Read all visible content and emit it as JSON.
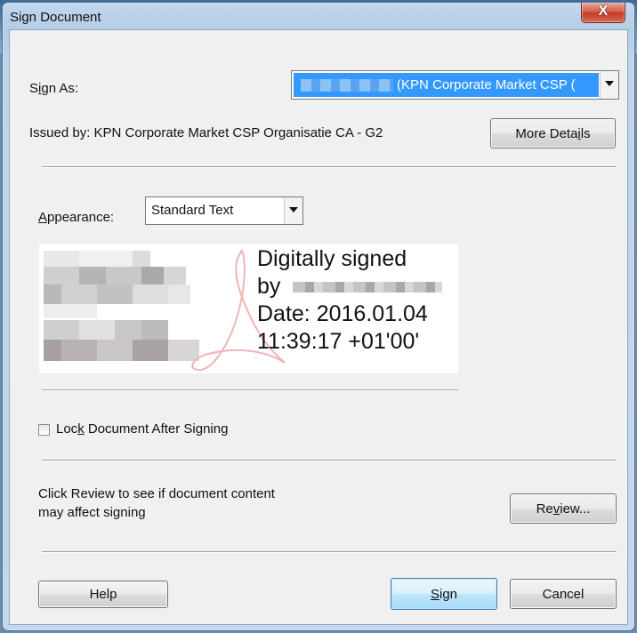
{
  "dialog": {
    "title": "Sign Document",
    "close_label": "X"
  },
  "sign_as": {
    "label_pre": "S",
    "label_key": "i",
    "label_post": "gn As:",
    "selected_value": "(KPN Corporate Market CSP ("
  },
  "issued_by": {
    "text": "Issued by: KPN Corporate Market CSP Organisatie CA - G2"
  },
  "more_details": {
    "label_pre": "More Deta",
    "label_key": "i",
    "label_post": "ls"
  },
  "appearance": {
    "label_key": "A",
    "label_post": "ppearance:",
    "selected_value": "Standard Text"
  },
  "signature_preview": {
    "line1": "Digitally signed",
    "line2": "by",
    "line3": "Date: 2016.01.04",
    "line4": "11:39:17 +01'00'"
  },
  "lock_document": {
    "label_pre": "Loc",
    "label_key": "k",
    "label_post": " Document After Signing",
    "checked": false
  },
  "review": {
    "line1": "Click Review to see if document content",
    "line2": "may affect signing",
    "button_pre": "Re",
    "button_key": "v",
    "button_post": "iew..."
  },
  "footer": {
    "help_label": "Help",
    "sign_key": "S",
    "sign_post": "ign",
    "cancel_label": "Cancel"
  },
  "colors": {
    "selection": "#3399ff",
    "window_frame": "#b9d1ea",
    "primary_border": "#3c7fb1"
  }
}
